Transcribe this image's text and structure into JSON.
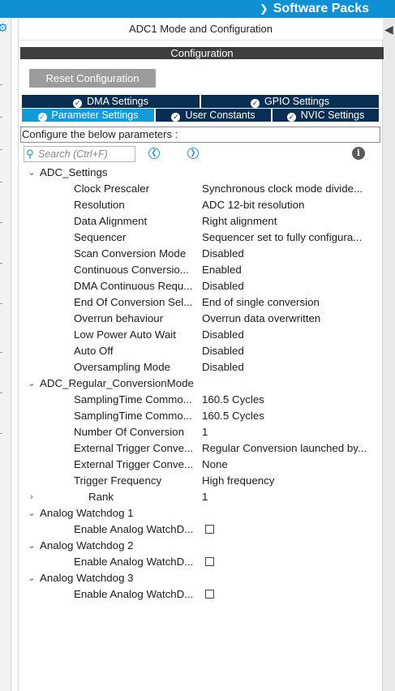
{
  "header": {
    "software_packs": "Software Packs"
  },
  "panel": {
    "mode_title": "ADC1 Mode and Configuration",
    "configuration_title": "Configuration",
    "reset_button": "Reset Configuration",
    "tabs_row1": [
      {
        "label": "DMA Settings"
      },
      {
        "label": "GPIO Settings"
      }
    ],
    "tabs_row2": [
      {
        "label": "Parameter Settings",
        "active": true
      },
      {
        "label": "User Constants"
      },
      {
        "label": "NVIC Settings"
      }
    ],
    "instruction": "Configure the below parameters :",
    "search": {
      "placeholder": "Search (Ctrl+F)"
    }
  },
  "params": {
    "groups": [
      {
        "name": "ADC_Settings",
        "expanded": true
      },
      {
        "name": "ADC_Regular_ConversionMode",
        "expanded": true
      },
      {
        "name": "Analog Watchdog 1",
        "expanded": true
      },
      {
        "name": "Analog Watchdog 2",
        "expanded": true
      },
      {
        "name": "Analog Watchdog 3",
        "expanded": true
      }
    ],
    "adc_settings": [
      {
        "name": "Clock Prescaler",
        "value": "Synchronous clock mode divide..."
      },
      {
        "name": "Resolution",
        "value": "ADC 12-bit resolution"
      },
      {
        "name": "Data Alignment",
        "value": "Right alignment"
      },
      {
        "name": "Sequencer",
        "value": "Sequencer set to fully configura..."
      },
      {
        "name": "Scan Conversion Mode",
        "value": "Disabled"
      },
      {
        "name": "Continuous Conversio...",
        "value": "Enabled"
      },
      {
        "name": "DMA Continuous Requ...",
        "value": "Disabled"
      },
      {
        "name": "End Of Conversion Sel...",
        "value": "End of single conversion"
      },
      {
        "name": "Overrun behaviour",
        "value": "Overrun data overwritten"
      },
      {
        "name": "Low Power Auto Wait",
        "value": "Disabled"
      },
      {
        "name": "Auto Off",
        "value": "Disabled"
      },
      {
        "name": "Oversampling Mode",
        "value": "Disabled"
      }
    ],
    "regular_conversion": [
      {
        "name": "SamplingTime Commo...",
        "value": "160.5 Cycles"
      },
      {
        "name": "SamplingTime Commo...",
        "value": "160.5 Cycles"
      },
      {
        "name": "Number Of Conversion",
        "value": "1"
      },
      {
        "name": "External Trigger Conve...",
        "value": "Regular Conversion launched by..."
      },
      {
        "name": "External Trigger Conve...",
        "value": "None"
      },
      {
        "name": "Trigger Frequency",
        "value": "High frequency"
      }
    ],
    "rank": {
      "name": "Rank",
      "value": "1",
      "expanded": false
    },
    "watchdog_enable_label": "Enable Analog WatchD...",
    "watchdog_enabled": [
      false,
      false,
      false
    ]
  }
}
